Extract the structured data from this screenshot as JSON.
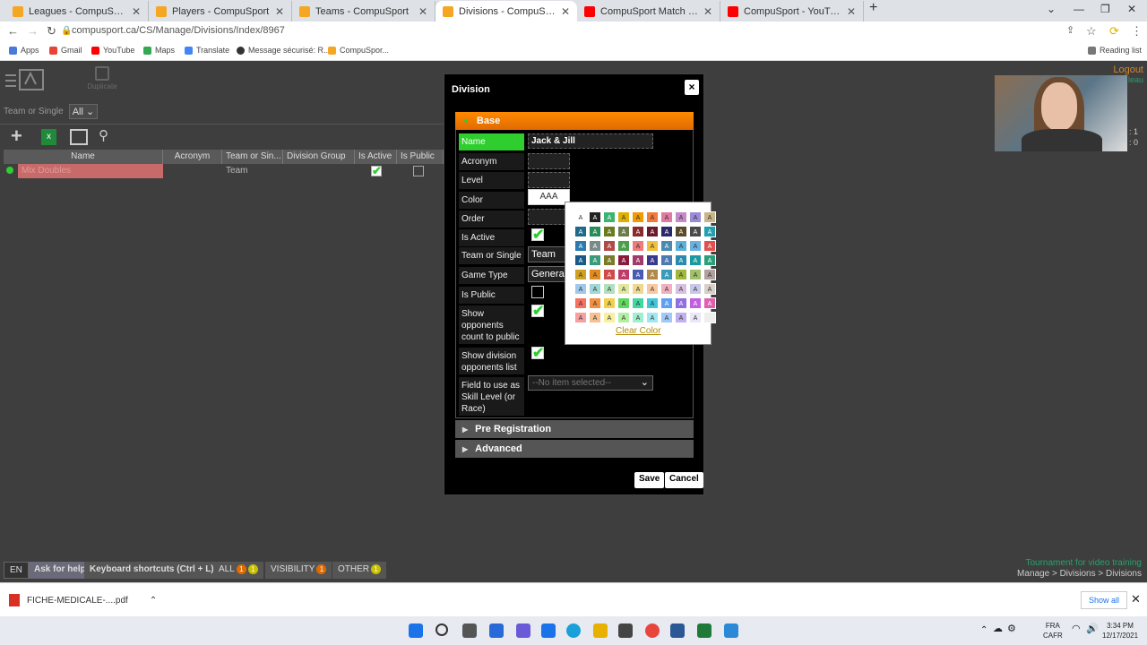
{
  "browser": {
    "tabs": [
      {
        "title": "Leagues - CompuSport",
        "active": false,
        "color": "#f5a623"
      },
      {
        "title": "Players - CompuSport",
        "active": false,
        "color": "#f5a623"
      },
      {
        "title": "Teams - CompuSport",
        "active": false,
        "color": "#f5a623"
      },
      {
        "title": "Divisions - CompuSport",
        "active": true,
        "color": "#f5a623"
      },
      {
        "title": "CompuSport Match Videos - Yo...",
        "active": false,
        "color": "#ff0000"
      },
      {
        "title": "CompuSport - YouTube",
        "active": false,
        "color": "#ff0000"
      }
    ],
    "url": "compusport.ca/CS/Manage/Divisions/Index/8967",
    "bookmarks": [
      "Apps",
      "Gmail",
      "YouTube",
      "Maps",
      "Translate",
      "Message sécurisé: R...",
      "CompuSpor..."
    ],
    "reading_list": "Reading list"
  },
  "app": {
    "duplicate_label": "Duplicate",
    "logout_label": "Logout",
    "filter_label": "Team or Single",
    "filter_value": "All",
    "columns": [
      "Name",
      "Acronym",
      "Team or Sin...",
      "Division Group",
      "Is Active",
      "Is Public"
    ],
    "rows": [
      {
        "name": "Mix Doubles",
        "acronym": "",
        "team_or_single": "Team",
        "group": "",
        "is_active": true,
        "is_public": false
      }
    ]
  },
  "modal": {
    "title": "Division",
    "close_label": "×",
    "sections": {
      "base": "Base",
      "pre_registration": "Pre Registration",
      "advanced": "Advanced"
    },
    "fields": {
      "name_label": "Name",
      "name_value": "Jack & Jill",
      "acronym_label": "Acronym",
      "level_label": "Level",
      "color_label": "Color",
      "color_value": "AAA",
      "order_label": "Order",
      "is_active_label": "Is Active",
      "team_or_single_label": "Team or Single",
      "team_or_single_value": "Team",
      "game_type_label": "Game Type",
      "game_type_value": "General",
      "is_public_label": "Is Public",
      "show_opponents_label": "Show opponents count to public",
      "show_division_opponents_label": "Show division opponents list",
      "skill_field_label": "Field to use as Skill Level (or Race)",
      "skill_field_placeholder": "--No item selected--"
    },
    "checks": {
      "is_active": true,
      "is_public": false,
      "show_opponents": true,
      "show_division_opponents": true
    },
    "save_label": "Save",
    "cancel_label": "Cancel"
  },
  "color_picker": {
    "swatch_glyph": "A",
    "clear_label": "Clear Color",
    "rows": [
      [
        "#ffffff",
        "#222222",
        "#3cb371",
        "#e0b000",
        "#f29a00",
        "#f27a3a",
        "#e07aa0",
        "#c48ac8",
        "#9a8ad8",
        "#c8b48a"
      ],
      [
        "#1f6a8a",
        "#2a8a5a",
        "#6a7a20",
        "#6b7a4a",
        "#8a2a2a",
        "#6a1a2a",
        "#2a2a6a",
        "#5a4a2a",
        "#4a4a4a",
        "#20a0b0"
      ],
      [
        "#2a7ab0",
        "#7a8a8a",
        "#b04a4a",
        "#4aa04a",
        "#f07a7a",
        "#f0c03a",
        "#4a8ab0",
        "#5ab0d8",
        "#6ab0e0",
        "#e05050"
      ],
      [
        "#1a5a8a",
        "#3a9a7a",
        "#7a7a2a",
        "#8a1a3a",
        "#a03a6a",
        "#3a3a8a",
        "#4a7ab0",
        "#2a8ab0",
        "#1a9aa0",
        "#2aa07a"
      ],
      [
        "#d0a020",
        "#e08a20",
        "#d04a4a",
        "#c03a6a",
        "#4a5ab0",
        "#b08a4a",
        "#3a9ab8",
        "#a0b83a",
        "#a0c06a",
        "#b0a0a0"
      ],
      [
        "#a0c8e8",
        "#a0d8d8",
        "#b0e0c0",
        "#e0e8a0",
        "#f0d890",
        "#f8c8a0",
        "#f0b0c0",
        "#d8c0e0",
        "#c8c8e8",
        "#d8d0c8"
      ],
      [
        "#f87060",
        "#f09040",
        "#f0d050",
        "#60d860",
        "#40d8a0",
        "#40c8d8",
        "#60a0f0",
        "#9070e0",
        "#c060e0",
        "#e060b0"
      ],
      [
        "#f8a0a0",
        "#f8c090",
        "#f8f0a0",
        "#b0f0a0",
        "#a0f0d0",
        "#a0e8f0",
        "#a0c8f8",
        "#c0b0f0",
        "#e8e8f8",
        "#eeeeee"
      ]
    ]
  },
  "footer": {
    "en": "EN",
    "help": "Ask for help",
    "shortcuts": "Keyboard shortcuts (Ctrl + L)",
    "all_label": "ALL",
    "all_count_red": "1",
    "all_count_yellow": "1",
    "visibility_label": "VISIBILITY",
    "visibility_count": "1",
    "other_label": "OTHER",
    "other_count": "1",
    "tournament": "Tournament for video training",
    "breadcrumb": "Manage > Divisions > Divisions"
  },
  "downloads": {
    "file": "FICHE-MEDICALE-....pdf",
    "show_all": "Show all"
  },
  "taskbar": {
    "lang1": "FRA",
    "lang2": "CAFR",
    "time": "3:34 PM",
    "date": "12/17/2021"
  },
  "webcam_text": {
    "side1": "leau",
    "side2": ": 1",
    "side3": ": 0"
  }
}
